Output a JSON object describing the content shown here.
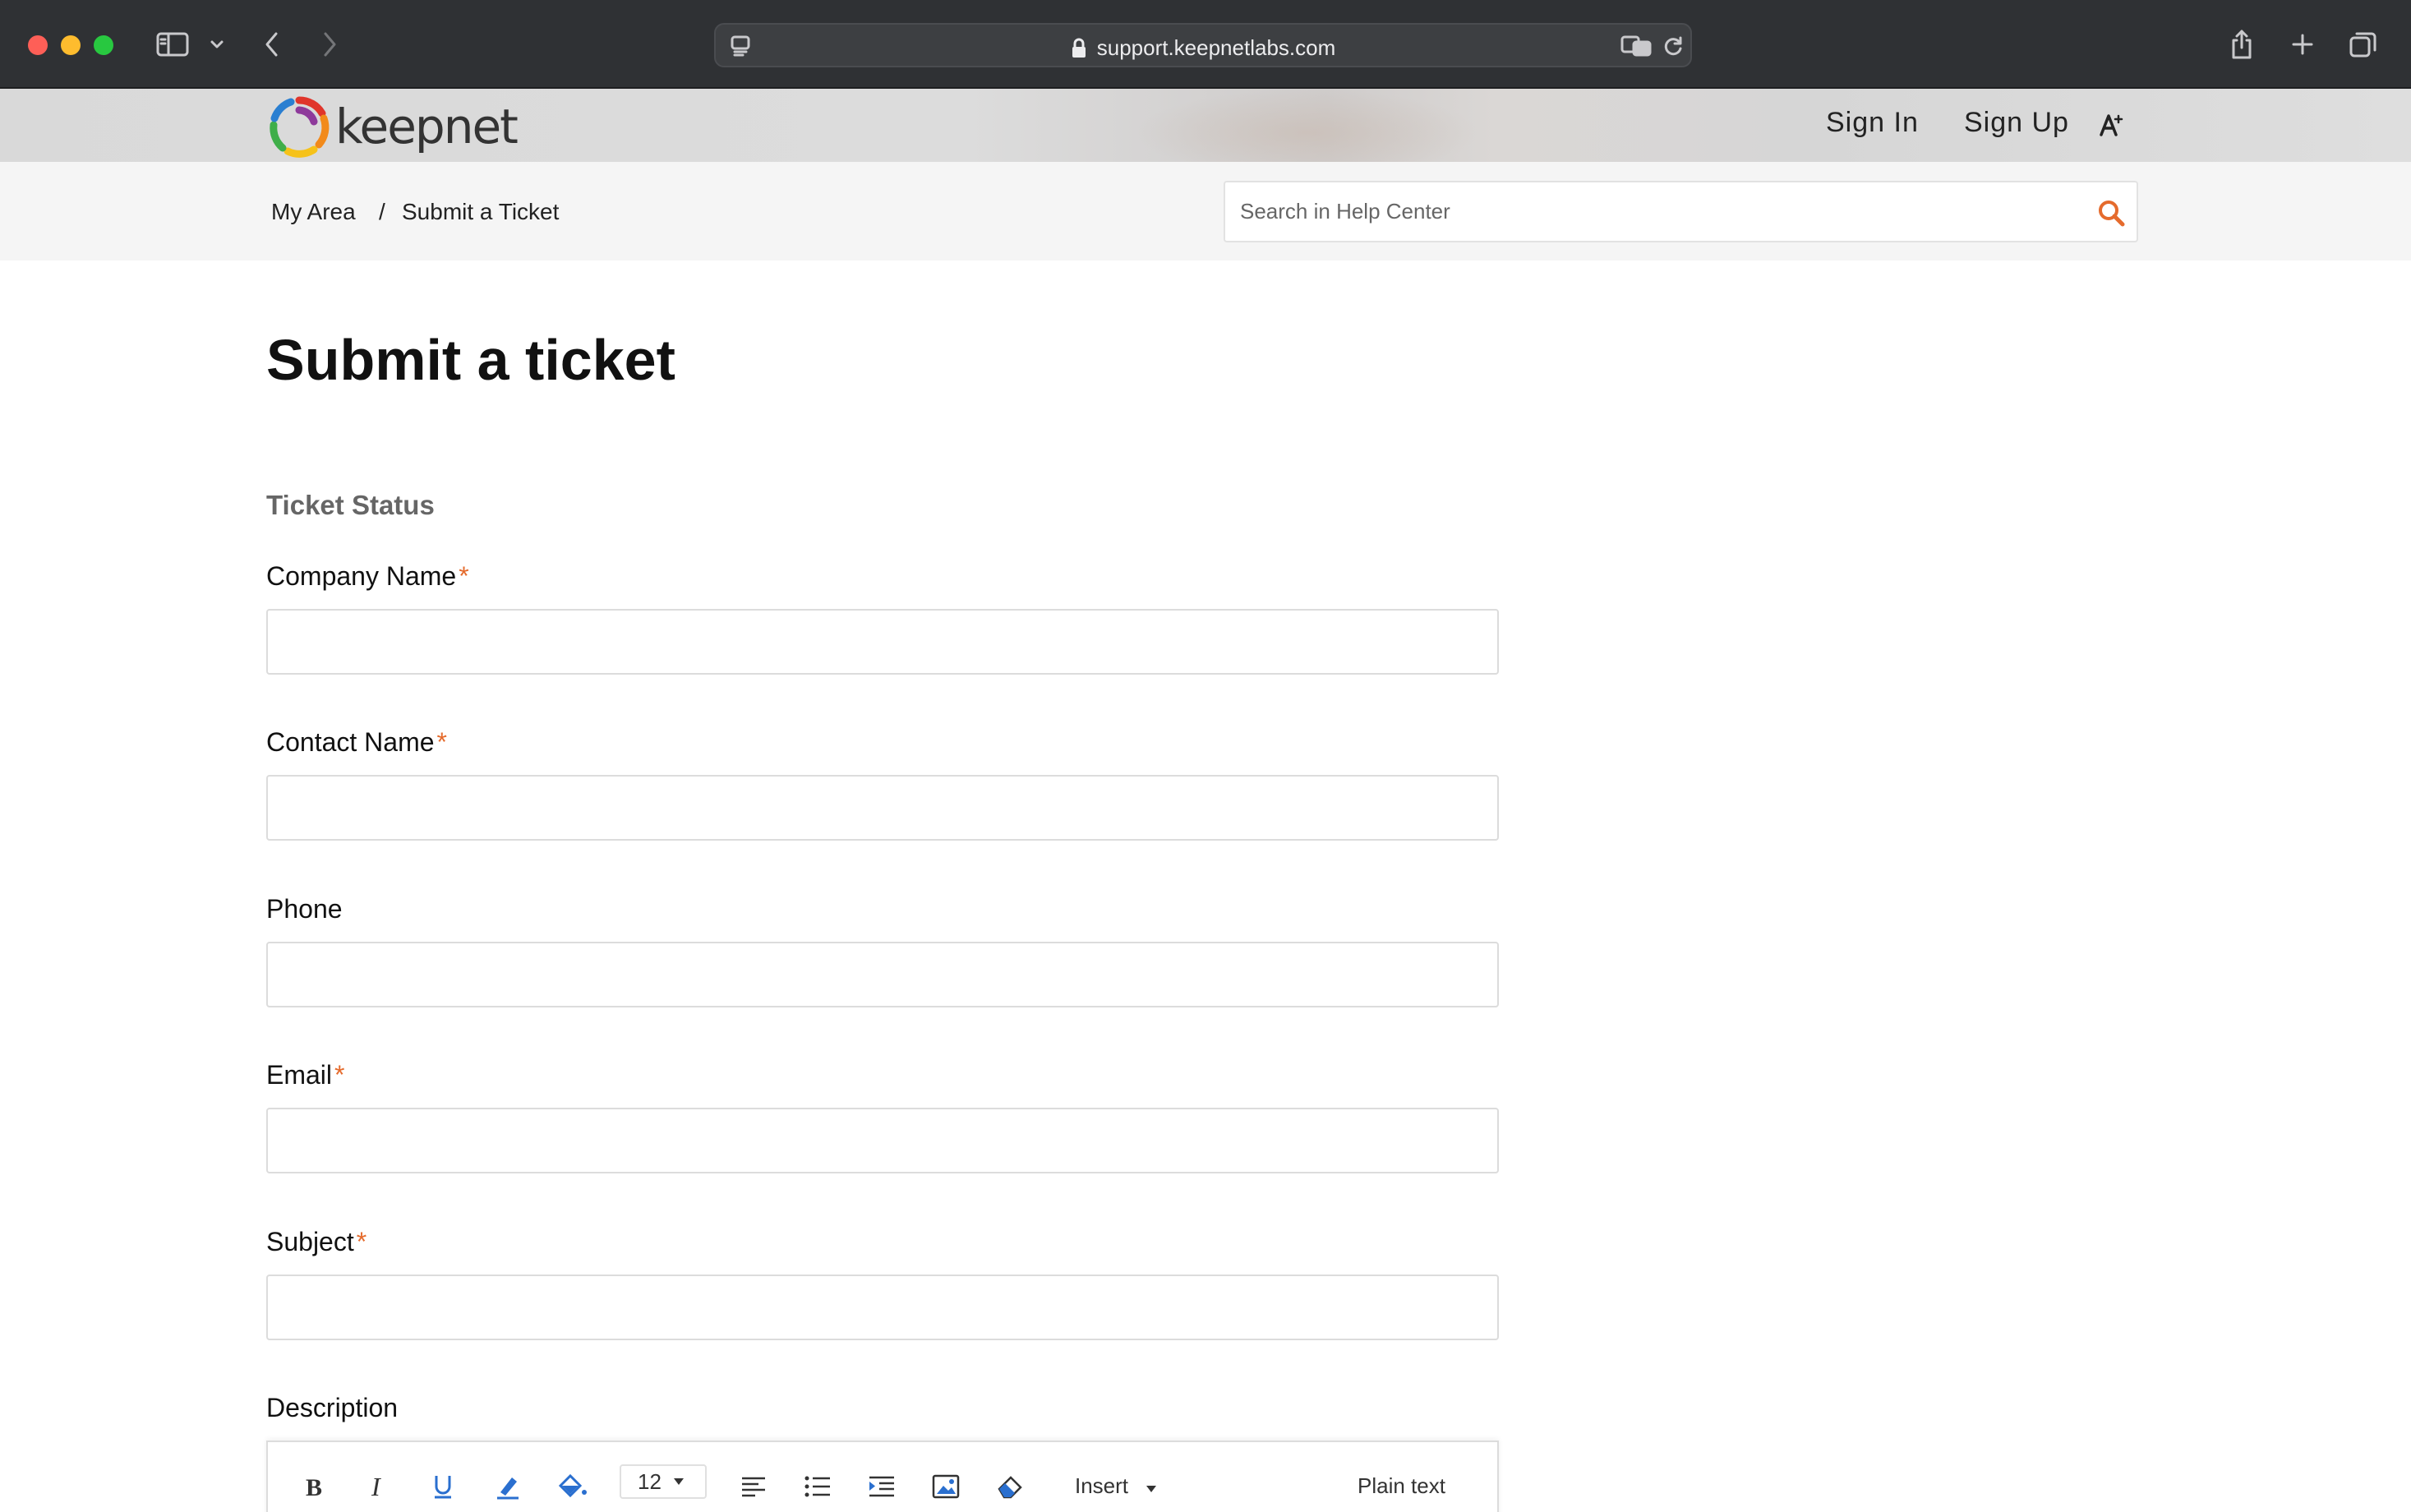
{
  "browser": {
    "url": "support.keepnetlabs.com"
  },
  "header": {
    "logo_text": "keepnet",
    "sign_in": "Sign In",
    "sign_up": "Sign Up"
  },
  "breadcrumb": {
    "items": [
      "My Area",
      "Submit a Ticket"
    ],
    "separator": "/"
  },
  "search": {
    "placeholder": "Search in Help Center",
    "value": ""
  },
  "page": {
    "title": "Submit a ticket",
    "section_title": "Ticket Status"
  },
  "form": {
    "fields": [
      {
        "label": "Company Name",
        "required": "*",
        "value": ""
      },
      {
        "label": "Contact Name",
        "required": "*",
        "value": ""
      },
      {
        "label": "Phone",
        "required": "",
        "value": ""
      },
      {
        "label": "Email",
        "required": "*",
        "value": ""
      },
      {
        "label": "Subject",
        "required": "*",
        "value": ""
      }
    ],
    "description_label": "Description"
  },
  "editor_toolbar": {
    "font_size": "12",
    "insert_label": "Insert",
    "plain_text_label": "Plain text",
    "icons": [
      "bold-icon",
      "italic-icon",
      "underline-icon",
      "text-color-icon",
      "background-color-icon",
      "font-size-dropdown",
      "align-icon",
      "list-icon",
      "indent-icon",
      "image-icon",
      "clear-format-icon"
    ]
  },
  "colors": {
    "accent": "#e56b2d",
    "chrome": "#2f3134"
  }
}
